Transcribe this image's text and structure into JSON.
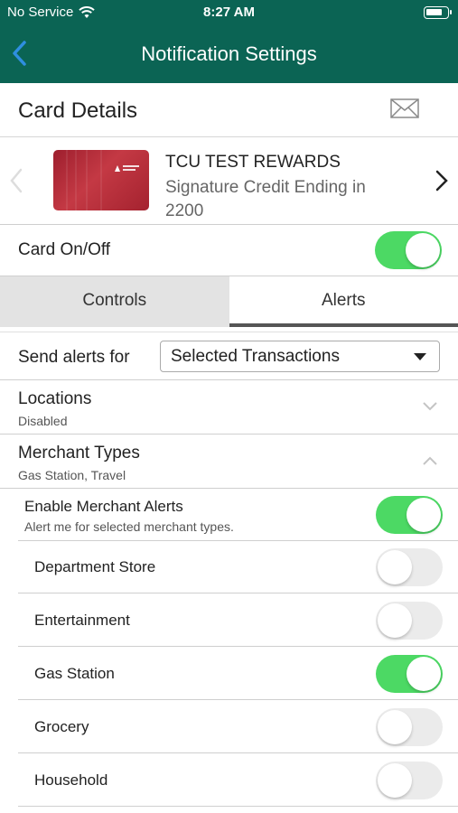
{
  "status_bar": {
    "carrier": "No Service",
    "time": "8:27 AM",
    "icons": [
      "wifi-icon",
      "battery-icon"
    ]
  },
  "nav": {
    "title": "Notification Settings",
    "back_icon": "chevron-left-icon",
    "accent_color": "#0b6454",
    "back_color": "#2f8fe0"
  },
  "card_details": {
    "header": "Card Details",
    "mail_icon": "envelope-icon",
    "card_name": "TCU TEST REWARDS",
    "card_description": "Signature Credit Ending in 2200"
  },
  "card_on_off": {
    "label": "Card On/Off",
    "enabled": true
  },
  "tabs": [
    {
      "label": "Controls",
      "active": false
    },
    {
      "label": "Alerts",
      "active": true
    }
  ],
  "send_alerts": {
    "label": "Send alerts for",
    "selected": "Selected Transactions"
  },
  "locations": {
    "title": "Locations",
    "status": "Disabled",
    "expanded": false
  },
  "merchant_types": {
    "title": "Merchant Types",
    "summary": "Gas Station, Travel",
    "expanded": true,
    "enable": {
      "title": "Enable Merchant Alerts",
      "subtitle": "Alert me for selected merchant types.",
      "enabled": true
    },
    "items": [
      {
        "label": "Department Store",
        "enabled": false
      },
      {
        "label": "Entertainment",
        "enabled": false
      },
      {
        "label": "Gas Station",
        "enabled": true
      },
      {
        "label": "Grocery",
        "enabled": false
      },
      {
        "label": "Household",
        "enabled": false
      }
    ]
  },
  "toggle_on_color": "#4cd964"
}
